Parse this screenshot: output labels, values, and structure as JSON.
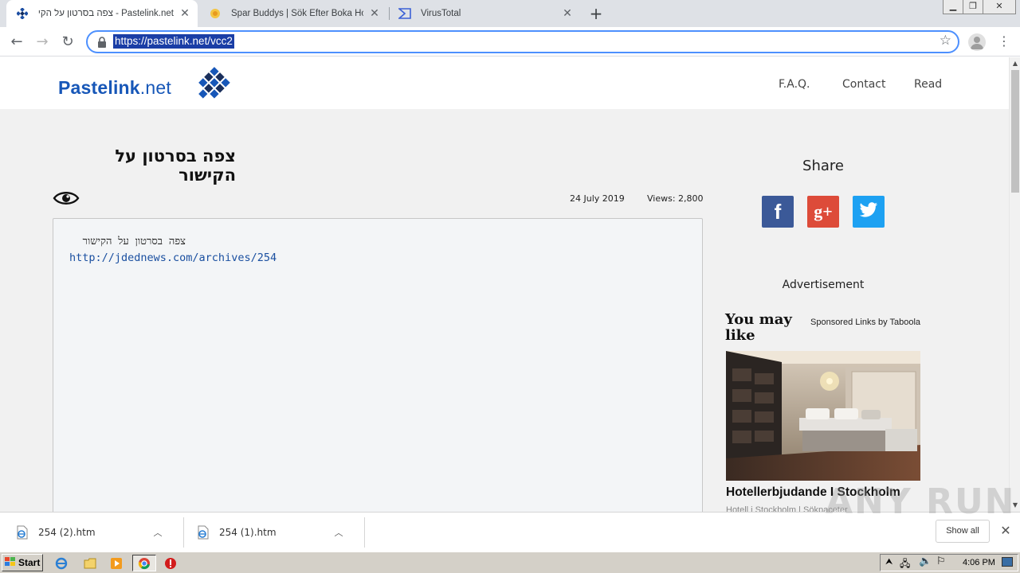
{
  "browser": {
    "tabs": [
      {
        "title": "Pastelink.net - צפה בסרטון על הקישור",
        "active": true
      },
      {
        "title": "Spar Buddys | Sök Efter Boka Hotell I",
        "active": false
      },
      {
        "title": "VirusTotal",
        "active": false
      }
    ],
    "newtab_label": "+",
    "url": "https://pastelink.net/vcc2"
  },
  "site": {
    "logo_main": "Pastelink",
    "logo_suffix": ".net",
    "nav": [
      "F.A.Q.",
      "Contact",
      "Read"
    ]
  },
  "paste": {
    "title": "צפה בסרטון על הקישור",
    "date": "24 July 2019",
    "views": "Views: 2,800",
    "content_text": "צפה בסרטון על הקישור",
    "content_link": "http://jdednews.com/archives/254"
  },
  "sidebar": {
    "share_title": "Share",
    "advertisement_label": "Advertisement",
    "you_may_like": "You may like",
    "sponsored": "Sponsored Links by Taboola",
    "ad_title": "Hotellerbjudande I Stockholm",
    "ad_source": "Hotell i Stockholm | Sökpaceter"
  },
  "downloads": {
    "items": [
      {
        "name": "254 (2).htm"
      },
      {
        "name": "254 (1).htm"
      }
    ],
    "show_all": "Show all"
  },
  "taskbar": {
    "start_label": "Start",
    "clock": "4:06 PM"
  },
  "watermark": "ANY RUN",
  "colors": {
    "brand_blue": "#1757b8",
    "facebook": "#3b5998",
    "google_plus": "#dd4b39",
    "twitter": "#1da1f2",
    "url_highlight": "#1a3ea6"
  },
  "icons": {
    "tab1": "pastelink-favicon",
    "tab2": "spar-buddys-favicon",
    "tab3": "virustotal-favicon",
    "eye": "eye-icon",
    "share": [
      "facebook-icon",
      "google-plus-icon",
      "twitter-icon"
    ]
  }
}
